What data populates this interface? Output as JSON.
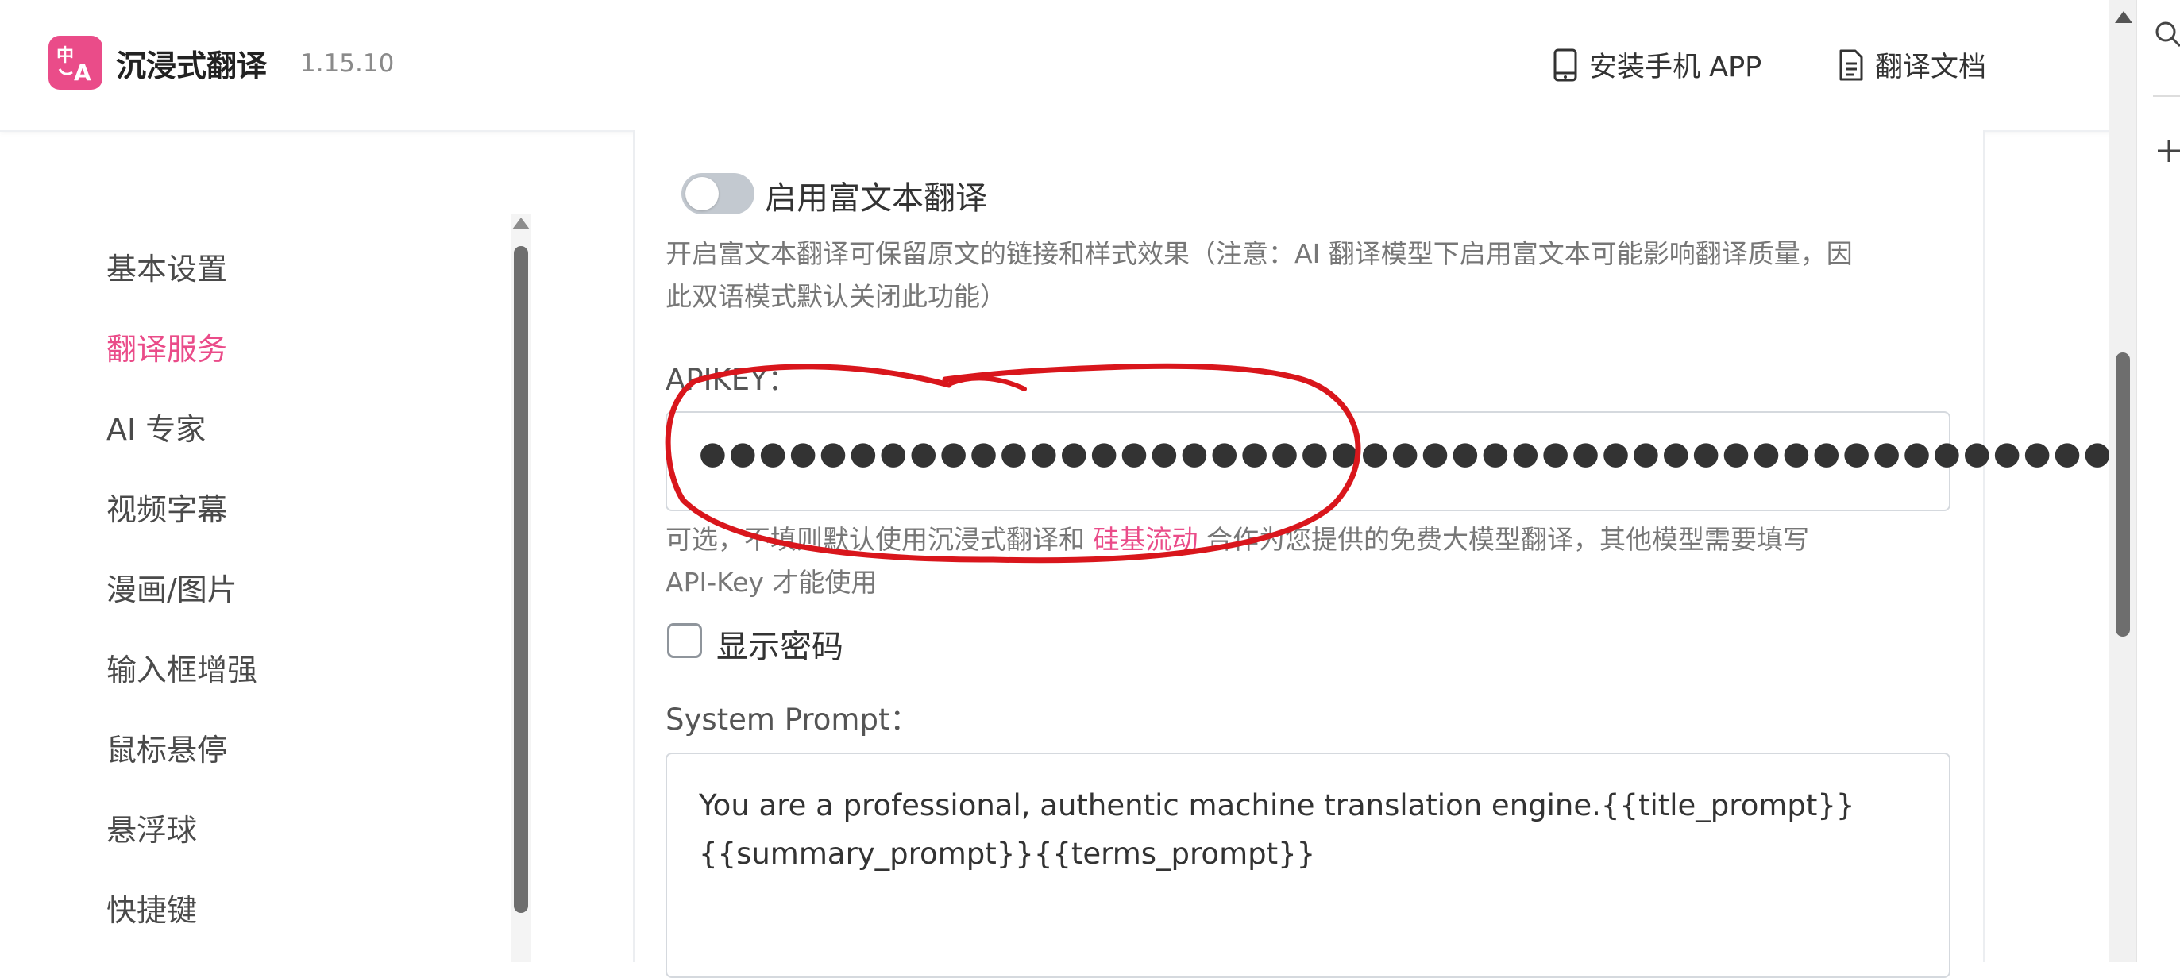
{
  "header": {
    "logo_glyph": "中A",
    "app_name": "沉浸式翻译",
    "version": "1.15.10",
    "install_app": "安装手机 APP",
    "docs": "翻译文档"
  },
  "sidebar": {
    "items": [
      {
        "label": "基本设置"
      },
      {
        "label": "翻译服务",
        "active": true
      },
      {
        "label": "AI 专家"
      },
      {
        "label": "视频字幕"
      },
      {
        "label": "漫画/图片"
      },
      {
        "label": "输入框增强"
      },
      {
        "label": "鼠标悬停"
      },
      {
        "label": "悬浮球"
      },
      {
        "label": "快捷键"
      }
    ]
  },
  "settings": {
    "rich_text_toggle_label": "启用富文本翻译",
    "rich_text_toggle_on": false,
    "rich_text_help_line1": "开启富文本翻译可保留原文的链接和样式效果（注意：AI 翻译模型下启用富文本可能影响翻译质量，因",
    "rich_text_help_line2": "此双语模式默认关闭此功能）",
    "apikey_label": "APIKEY：",
    "apikey_value": "●●●●●●●●●●●●●●●●●●●●●●●●●●●●●●●●●●●●●●●●●●●●●●●●●●●",
    "apikey_help_prefix": "可选，不填则默认使用沉浸式翻译和 ",
    "apikey_help_link": "硅基流动",
    "apikey_help_suffix": " 合作为您提供的免费大模型翻译，其他模型需要填写",
    "apikey_help_line2": "API-Key 才能使用",
    "show_password_label": "显示密码",
    "show_password_checked": false,
    "system_prompt_label": "System Prompt：",
    "system_prompt_value": "You are a professional, authentic machine translation engine.{{title_prompt}}\n{{summary_prompt}}{{terms_prompt}}"
  },
  "colors": {
    "accent": "#ea4c89",
    "annotation": "#d9161c"
  },
  "icons": {
    "phone": "phone-icon",
    "document": "document-icon",
    "search": "search-icon",
    "plus": "plus-icon"
  }
}
